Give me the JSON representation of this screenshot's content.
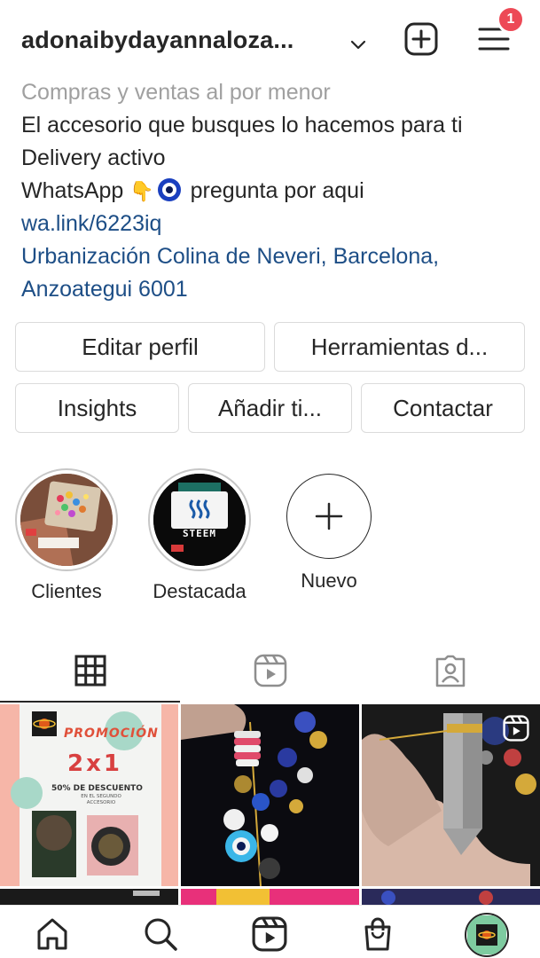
{
  "header": {
    "username": "adonaibydayannaloza...",
    "notification_count": "1"
  },
  "bio": {
    "category": "Compras y ventas al por menor",
    "line1": "El accesorio que busques lo hacemos para ti",
    "line2": "Delivery activo",
    "line3_start": "WhatsApp",
    "line3_hand": "👇",
    "line3_end": "pregunta por aqui",
    "link": "wa.link/6223iq",
    "address_line1": "Urbanización Colina de Neveri, Barcelona,",
    "address_line2": "Anzoategui 6001"
  },
  "buttons": {
    "edit_profile": "Editar perfil",
    "tools": "Herramientas d...",
    "insights": "Insights",
    "add": "Añadir ti...",
    "contact": "Contactar"
  },
  "highlights": [
    {
      "label": "Clientes"
    },
    {
      "label": "Destacada",
      "badge_text": "STEEM"
    },
    {
      "label": "Nuevo"
    }
  ],
  "grid": {
    "post1": {
      "title": "PROMOCIÓN",
      "offer": "2x1",
      "discount": "50% DE DESCUENTO",
      "subtext": "EN EL SEGUNDO ACCESORIO"
    }
  },
  "colors": {
    "accent_link": "#1d4e86",
    "notification": "#ed4956",
    "promo_bg": "#f6b6a8"
  }
}
